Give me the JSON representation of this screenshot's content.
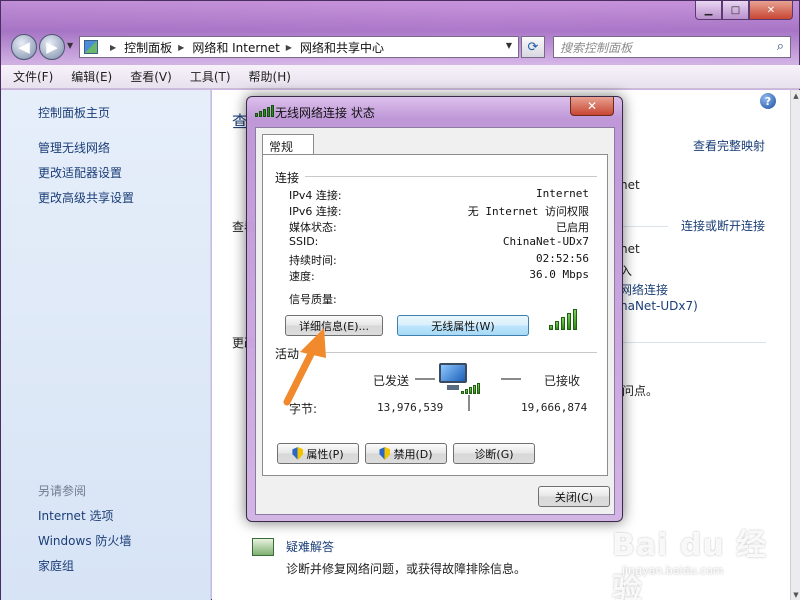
{
  "explorer": {
    "address": {
      "crumbs": [
        "控制面板",
        "网络和 Internet",
        "网络和共享中心"
      ]
    },
    "search_placeholder": "搜索控制面板",
    "menu": [
      "文件(F)",
      "编辑(E)",
      "查看(V)",
      "工具(T)",
      "帮助(H)"
    ],
    "left_pane": {
      "links": [
        "控制面板主页",
        "管理无线网络",
        "更改适配器设置",
        "更改高级共享设置"
      ],
      "see_also_header": "另请参阅",
      "see_also": [
        "Internet 选项",
        "Windows 防火墙",
        "家庭组"
      ]
    },
    "main_pane": {
      "heading_fragment": "查",
      "view_full_map": "查看完整映射",
      "net_fragment_1": "net",
      "view_fragment": "查看",
      "connect_disconnect": "连接或断开连接",
      "net_fragment_2": "net",
      "access_fragment": "入",
      "wireless_conn_fragment": "网络连接",
      "ssid_fragment": "naNet-UDx7)",
      "change_fragment": "更改",
      "access_point_fragment": "问点。",
      "troubleshoot_link": "疑难解答",
      "troubleshoot_desc": "诊断并修复网络问题，或获得故障排除信息。"
    }
  },
  "dialog": {
    "title": "无线网络连接 状态",
    "tab": "常规",
    "connection_group": "连接",
    "rows": [
      {
        "label": "IPv4 连接:",
        "value": "Internet"
      },
      {
        "label": "IPv6 连接:",
        "value": "无 Internet 访问权限"
      },
      {
        "label": "媒体状态:",
        "value": "已启用"
      },
      {
        "label": "SSID:",
        "value": "ChinaNet-UDx7"
      },
      {
        "label": "持续时间:",
        "value": "02:52:56"
      },
      {
        "label": "速度:",
        "value": "36.0 Mbps"
      }
    ],
    "signal_label": "信号质量:",
    "signal_level": 5,
    "signal_max": 5,
    "details_button": "详细信息(E)...",
    "wireless_props_button": "无线属性(W)",
    "activity_group": "活动",
    "sent_label": "已发送",
    "received_label": "已接收",
    "bytes_label": "字节:",
    "bytes_sent": "13,976,539",
    "bytes_received": "19,666,874",
    "properties_button": "属性(P)",
    "disable_button": "禁用(D)",
    "diagnose_button": "诊断(G)",
    "close_button": "关闭(C)"
  },
  "colors": {
    "annotation_arrow": "#f08a2c",
    "link_blue": "#1b3e77",
    "signal_green": "#2f8a17"
  },
  "watermark": {
    "logo": "Bai du 经验",
    "url": "jingyan.baidu.com"
  }
}
